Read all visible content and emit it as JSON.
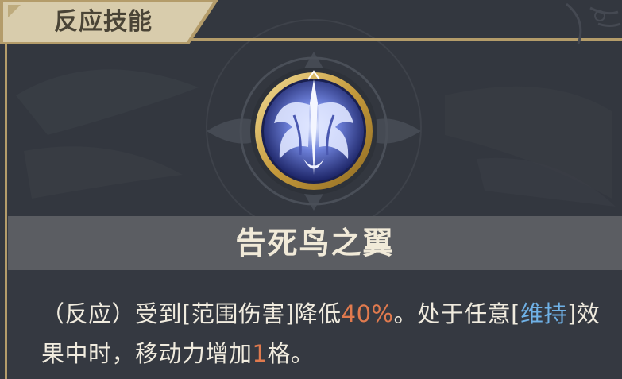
{
  "header": {
    "title": "反应技能"
  },
  "skill": {
    "name": "告死鸟之翼",
    "icon": "winged-bird-emblem-icon"
  },
  "description": {
    "p1": "（反应）受到[范围伤害]降低",
    "value1": "40%",
    "p2": "。处于任意[",
    "keyword": "维持",
    "p3": "]效果中时，移动力增加",
    "value2": "1",
    "p4": "格。"
  },
  "colors": {
    "panel_bg": "#33373f",
    "gold": "#b49c6a",
    "tab_bg": "#d8ccac",
    "highlight_orange": "#e07a4e",
    "highlight_blue": "#6fb1e6",
    "text": "#f0ebde"
  }
}
